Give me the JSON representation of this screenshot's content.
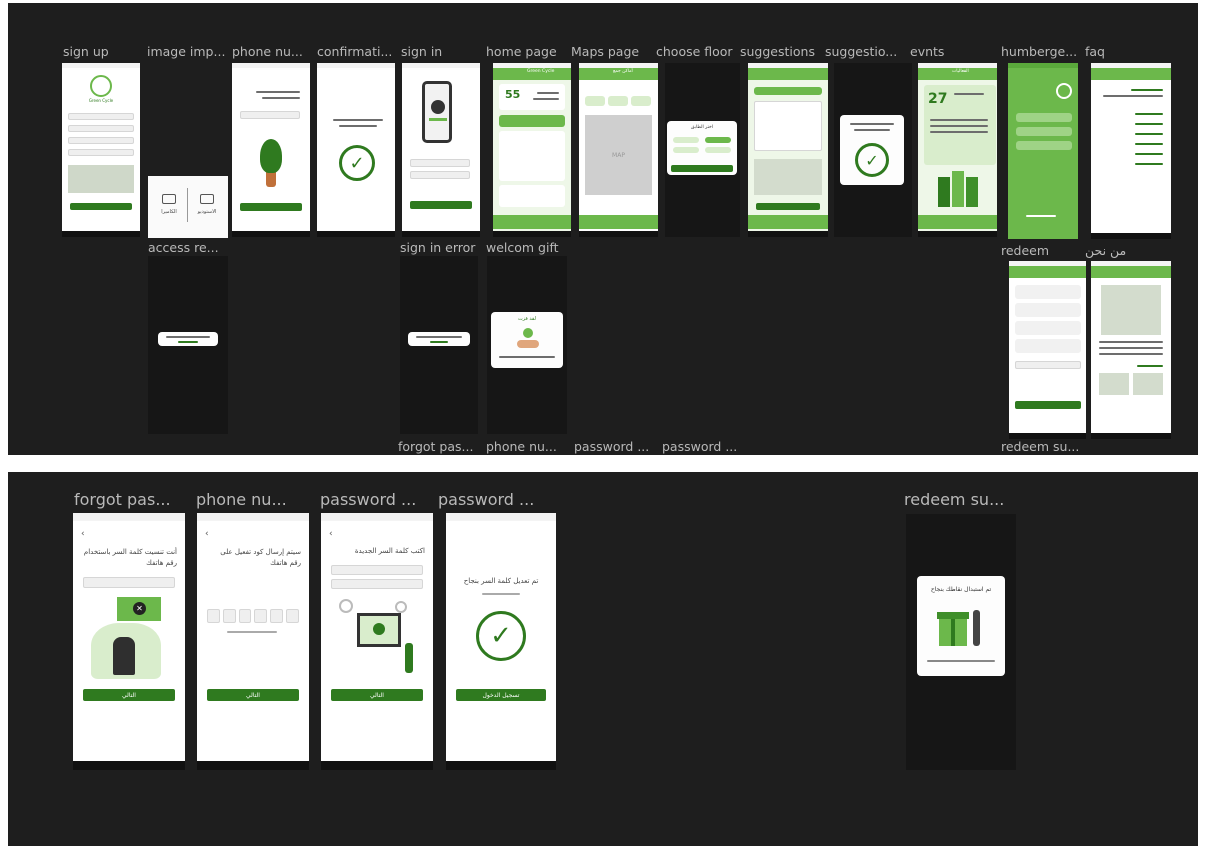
{
  "top_labels": {
    "sign_up": "sign up",
    "image_import": "image imp...",
    "phone_number": "phone nu...",
    "confirmation": "confirmati...",
    "sign_in": "sign in",
    "home_page": "home page",
    "maps_page": "Maps page",
    "choose_floor": "choose floor",
    "suggestions": "suggestions",
    "suggestion_sent": "suggestio...",
    "events": "evnts",
    "hamburger": "humberge...",
    "faq": "faq",
    "access_request": "access re...",
    "sign_in_error": "sign in error",
    "welcome_gift": "welcom gift",
    "redeem": "redeem",
    "about_us": "من نحن",
    "forgot_password": "forgot pas...",
    "phone_number_2": "phone nu...",
    "password_1": "password ...",
    "password_2": "password ...",
    "redeem_success": "redeem su..."
  },
  "bottom_labels": {
    "forgot_password": "forgot pas...",
    "phone_number": "phone nu...",
    "password_1": "password ...",
    "password_2": "password ...",
    "redeem_success": "redeem su..."
  },
  "screens": {
    "sign_up": {
      "app_name": "Green Cycle"
    },
    "image_import": {
      "camera_label": "الكاميرا",
      "gallery_label": "الاستوديو"
    },
    "home": {
      "app_title": "Green Cycle",
      "points": "55"
    },
    "maps": {
      "title": "أماكن جمع",
      "map_placeholder": "MAP"
    },
    "choose_floor": {
      "title": "اختر الطابق"
    },
    "events": {
      "date_number": "27",
      "title": "الفعاليات"
    },
    "welcome_gift": {
      "title": "لقد فزت"
    },
    "forgot_password": {
      "heading": "أنت تنسيت كلمة السر باستخدام رقم هاتفك",
      "button": "التالي"
    },
    "phone_code": {
      "heading": "سيتم إرسال كود تفعيل على رقم هاتفك",
      "button": "التالي"
    },
    "new_password": {
      "heading": "اكتب كلمة السر الجديدة",
      "button": "التالي"
    },
    "password_done": {
      "heading": "تم تعديل كلمة السر بنجاح",
      "button": "تسجيل الدخول"
    },
    "redeem_success": {
      "heading": "تم استبدال نقاطك بنجاح"
    }
  },
  "colors": {
    "panel": "#1e1e1e",
    "primary": "#2f7a1f",
    "accent": "#6cb84b",
    "light": "#d9edcc"
  },
  "icons": [
    "check-icon",
    "camera-icon",
    "folder-icon",
    "image-placeholder-icon",
    "back-arrow-icon",
    "avatar-icon",
    "phone-illustration",
    "plant-illustration"
  ]
}
